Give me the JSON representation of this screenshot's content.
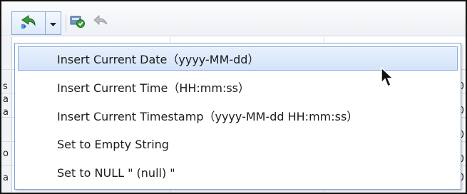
{
  "toolbar": {
    "split_button_icon": "insert-value-icon",
    "dropdown_icon": "dropdown-arrow-icon",
    "apply_icon": "apply-changes-icon",
    "disabled_icon": "revert-icon"
  },
  "menu": {
    "items": [
      {
        "label": "Insert Current Date（yyyy-MM-dd）",
        "state": "highlighted"
      },
      {
        "label": "Insert Current Time（HH:mm:ss）",
        "state": "normal"
      },
      {
        "label": "Insert Current Timestamp（yyyy-MM-dd HH:mm:ss）",
        "state": "normal"
      },
      {
        "label": "Set to Empty String",
        "state": "normal"
      },
      {
        "label": "Set to NULL \" (null) \"",
        "state": "normal"
      }
    ]
  },
  "background_grid": {
    "left_glyphs": [
      "s",
      "a",
      "a",
      "o",
      "a"
    ],
    "right_glyphs": [
      "0",
      "0",
      "0",
      "0",
      "0"
    ]
  },
  "colors": {
    "highlight": "#d4e4f9",
    "menu_border": "#7fa4d4",
    "icon_green": "#3a9b3a"
  }
}
